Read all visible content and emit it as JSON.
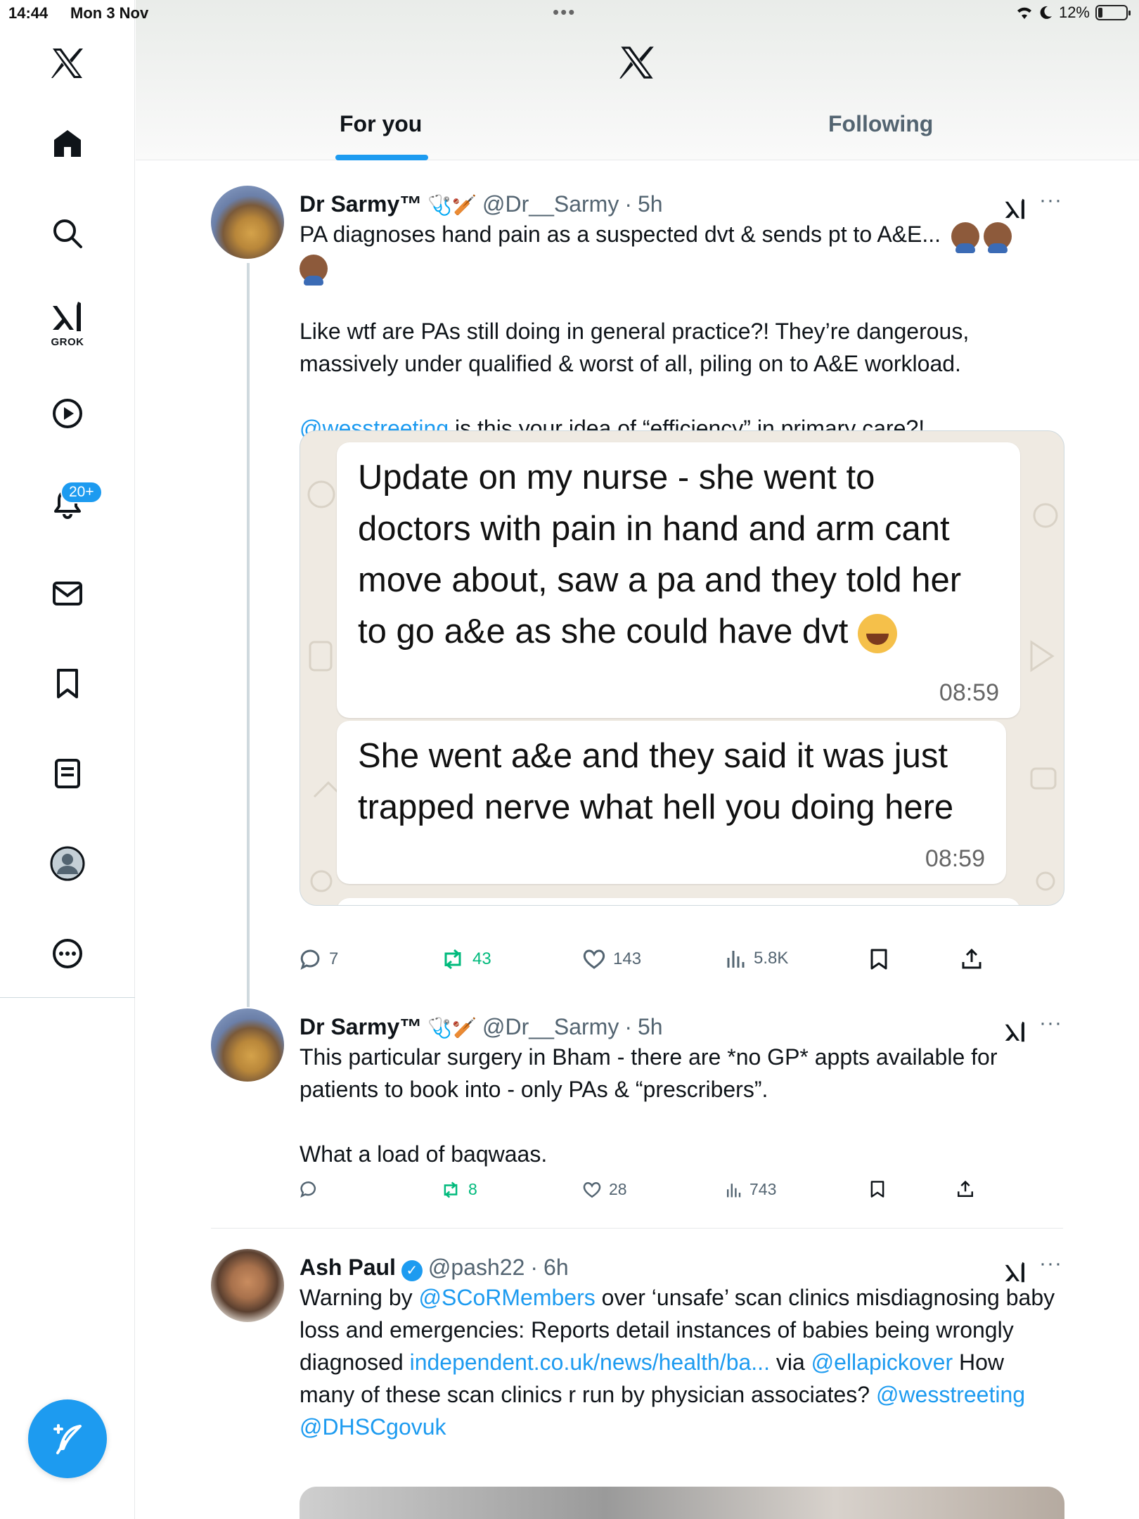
{
  "status_bar": {
    "time": "14:44",
    "date": "Mon 3 Nov",
    "battery": "12%"
  },
  "sidebar": {
    "grok_label": "GROK",
    "notification_badge": "20+",
    "items": [
      "home-icon",
      "search-icon",
      "grok-icon",
      "video-icon",
      "notifications-icon",
      "messages-icon",
      "bookmarks-icon",
      "lists-icon",
      "profile-icon",
      "more-icon"
    ]
  },
  "header": {
    "tabs": [
      "For you",
      "Following"
    ],
    "active_tab": "For you"
  },
  "posts": [
    {
      "name": "Dr Sarmy™",
      "name_emoji": "🩺🏏",
      "handle": "@Dr__Sarmy",
      "time": "5h",
      "text_line1": "PA diagnoses hand pain as a suspected dvt & sends pt to A&E...",
      "text_para2": "Like wtf are PAs still doing in general practice?! They’re dangerous, massively under qualified & worst of all, piling on to A&E workload.",
      "mention": "@wesstreeting",
      "text_para3_rest": " is this your idea of “efficiency” in primary care?!",
      "media": {
        "bubble1_text": "Update on my nurse - she went to doctors with pain in hand and arm cant move about, saw a pa and they told her to go a&e as she could have dvt",
        "bubble1_time": "08:59",
        "bubble2_text": "She went a&e and they said it was just trapped nerve what hell you doing here",
        "bubble2_time": "08:59"
      },
      "replies": "7",
      "reposts": "43",
      "likes": "143",
      "views": "5.8K"
    },
    {
      "name": "Dr Sarmy™",
      "name_emoji": "🩺🏏",
      "handle": "@Dr__Sarmy",
      "time": "5h",
      "text_para1": "This particular surgery in Bham - there are *no GP* appts available for patients to book into - only PAs & “prescribers”.",
      "text_para2": "What a load of baqwaas.",
      "replies": "",
      "reposts": "8",
      "likes": "28",
      "views": "743"
    },
    {
      "name": "Ash Paul",
      "handle": "@pash22",
      "time": "6h",
      "text_a": "Warning by ",
      "mention1": "@SCoRMembers",
      "text_b": " over ‘unsafe’ scan clinics misdiagnosing baby loss and emergencies: Reports detail instances of babies being wrongly diagnosed",
      "link": "independent.co.uk/news/health/ba...",
      "text_c": " via ",
      "mention2": "@ellapickover",
      "text_d": " How many of these scan clinics r run by physician associates? ",
      "mention3": "@wesstreeting",
      "mention4": "@DHSCgovuk"
    }
  ],
  "colors": {
    "accent": "#1d9bf0",
    "repost_green": "#00ba7c",
    "secondary_text": "#536471"
  }
}
